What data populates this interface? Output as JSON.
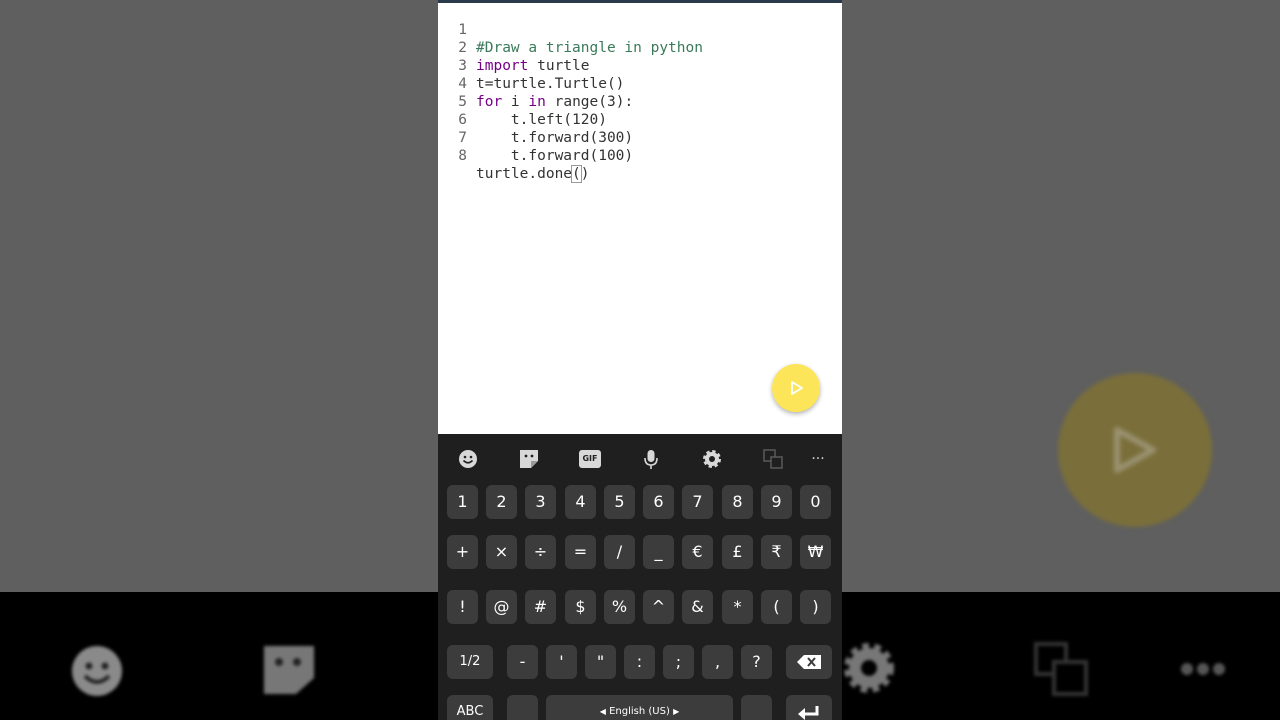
{
  "editor": {
    "lines": [
      {
        "num": "1",
        "text": "#Draw a triangle in python"
      },
      {
        "num": "2",
        "text": "import turtle"
      },
      {
        "num": "3",
        "text": "t=turtle.Turtle()"
      },
      {
        "num": "4",
        "text": "for i in range(3):"
      },
      {
        "num": "5",
        "text": "    t.left(120)"
      },
      {
        "num": "6",
        "text": "    t.forward(300)"
      },
      {
        "num": "7",
        "text": "    t.forward(100)"
      },
      {
        "num": "8",
        "text": "turtle.done()"
      }
    ],
    "line2_kw": "import",
    "line2_rest": " turtle",
    "line4_kw1": "for",
    "line4_mid": " i ",
    "line4_kw2": "in",
    "line4_rest": " range(3):",
    "line8_pre": "turtle.done",
    "line8_bracket": "(",
    "line8_post": ")"
  },
  "run_button_icon": "play-icon",
  "keyboard": {
    "toolbar": [
      "emoji-icon",
      "sticker-icon",
      "gif-icon",
      "microphone-icon",
      "settings-icon",
      "translate-icon",
      "more-icon"
    ],
    "gif_label": "GIF",
    "more_label": "···",
    "row1": [
      "1",
      "2",
      "3",
      "4",
      "5",
      "6",
      "7",
      "8",
      "9",
      "0"
    ],
    "row2": [
      "+",
      "×",
      "÷",
      "=",
      "/",
      "_",
      "€",
      "£",
      "₹",
      "₩"
    ],
    "row3": [
      "!",
      "@",
      "#",
      "$",
      "%",
      "^",
      "&",
      "*",
      "(",
      ")"
    ],
    "row4": [
      "1/2",
      "-",
      "'",
      "\"",
      ":",
      ";",
      ",",
      "?"
    ],
    "row5_left": "ABC",
    "language_label": "English (US)"
  },
  "colors": {
    "fab": "#fde55a",
    "keyboard_bg": "#1f1f1f",
    "key_bg": "#3c3c3c",
    "keyword": "#770088",
    "comment": "#3a7a5a"
  }
}
